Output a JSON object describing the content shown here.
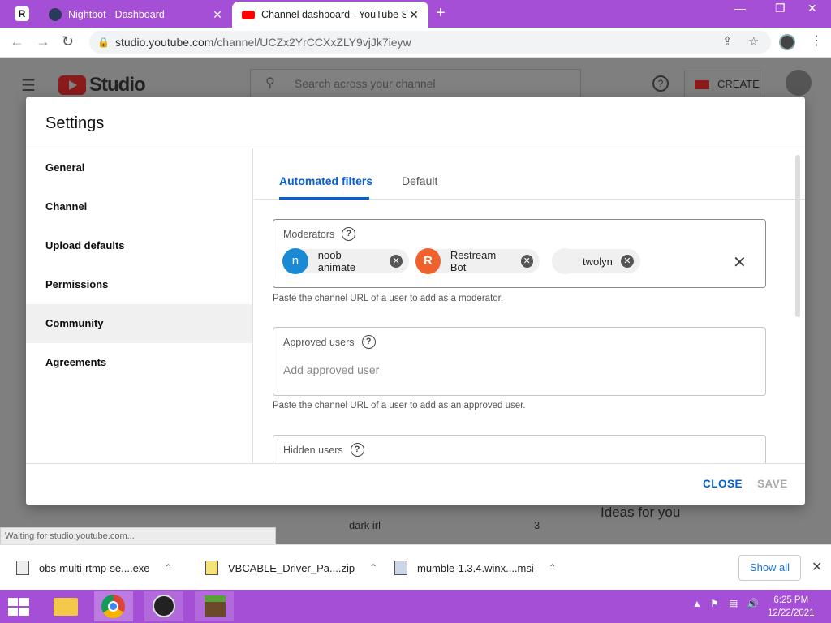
{
  "browser": {
    "tabs": [
      {
        "title": "Nightbot - Dashboard",
        "close": "✕"
      },
      {
        "title": "Channel dashboard - YouTube Stu",
        "close": "✕"
      }
    ],
    "new_tab": "+",
    "url_host": "studio.youtube.com",
    "url_path": "/channel/UCZx2YrCCXxZLY9vjJk7ieyw",
    "window_controls": [
      "—",
      "❐",
      "✕"
    ]
  },
  "youtube": {
    "logo_text": "Studio",
    "search_placeholder": "Search across your channel",
    "create_label": "CREATE",
    "bg_row_text": "dark irl",
    "bg_row_count": "3",
    "ideas_title": "Ideas for you"
  },
  "modal": {
    "title": "Settings",
    "sidebar": [
      "General",
      "Channel",
      "Upload defaults",
      "Permissions",
      "Community",
      "Agreements"
    ],
    "selected_sidebar": "Community",
    "tabs": {
      "active": "Automated filters",
      "inactive": "Default"
    },
    "moderators": {
      "label": "Moderators",
      "chips": [
        {
          "initial": "n",
          "name": "noob animate",
          "color": "#1a8ad4"
        },
        {
          "initial": "R",
          "name": "Restream Bot",
          "color": "#f0622d"
        },
        {
          "initial": "",
          "name": "twolyn",
          "color": "#f0f0f0"
        }
      ],
      "hint": "Paste the channel URL of a user to add as a moderator."
    },
    "approved": {
      "label": "Approved users",
      "placeholder": "Add approved user",
      "hint": "Paste the channel URL of a user to add as an approved user."
    },
    "hidden": {
      "label": "Hidden users"
    },
    "buttons": {
      "close": "CLOSE",
      "save": "SAVE"
    }
  },
  "status_text": "Waiting for studio.youtube.com...",
  "downloads": {
    "items": [
      "obs-multi-rtmp-se....exe",
      "VBCABLE_Driver_Pa....zip",
      "mumble-1.3.4.winx....msi"
    ],
    "show_all": "Show all"
  },
  "taskbar": {
    "time": "6:25 PM",
    "date": "12/22/2021"
  }
}
